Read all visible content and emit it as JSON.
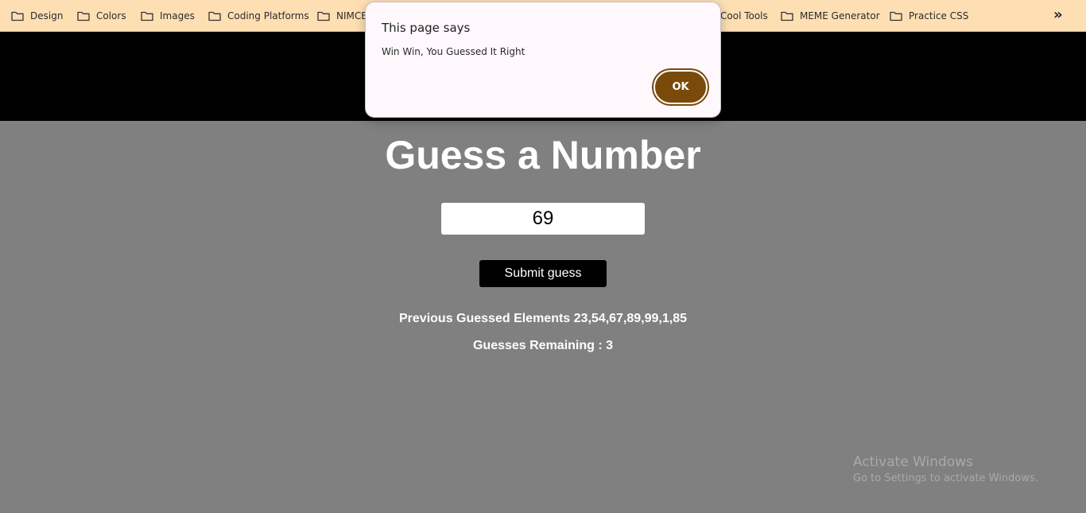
{
  "bookmarks": {
    "items": [
      {
        "label": "Design",
        "icon": "folder-icon"
      },
      {
        "label": "Colors",
        "icon": "folder-icon"
      },
      {
        "label": "Images",
        "icon": "folder-icon"
      },
      {
        "label": "Coding Platforms",
        "icon": "folder-icon"
      },
      {
        "label": "NIMCE",
        "icon": "folder-icon"
      },
      {
        "label": "Cool Tools",
        "icon": "folder-icon"
      },
      {
        "label": "MEME Generator",
        "icon": "folder-icon"
      },
      {
        "label": "Practice CSS",
        "icon": "folder-icon"
      }
    ],
    "overflow_icon": "double-chevron-right-icon",
    "overflow_glyph": "»"
  },
  "page": {
    "title": "Guess a Number",
    "guess_value": "69",
    "submit_label": "Submit guess",
    "previous_label": "Previous Guessed Elements 23,54,67,89,99,1,85",
    "remaining_label": "Guesses Remaining : 3"
  },
  "dialog": {
    "title": "This page says",
    "message": "Win Win, You Guessed It Right",
    "ok_label": "OK"
  },
  "watermark": {
    "title": "Activate Windows",
    "subtitle": "Go to Settings to activate Windows."
  },
  "colors": {
    "bookmarks_bar": "#fedfb4",
    "page_background": "#808080",
    "hero_band": "#000000",
    "dialog_background": "#fff8fd",
    "ok_button": "#7a4a0a"
  }
}
